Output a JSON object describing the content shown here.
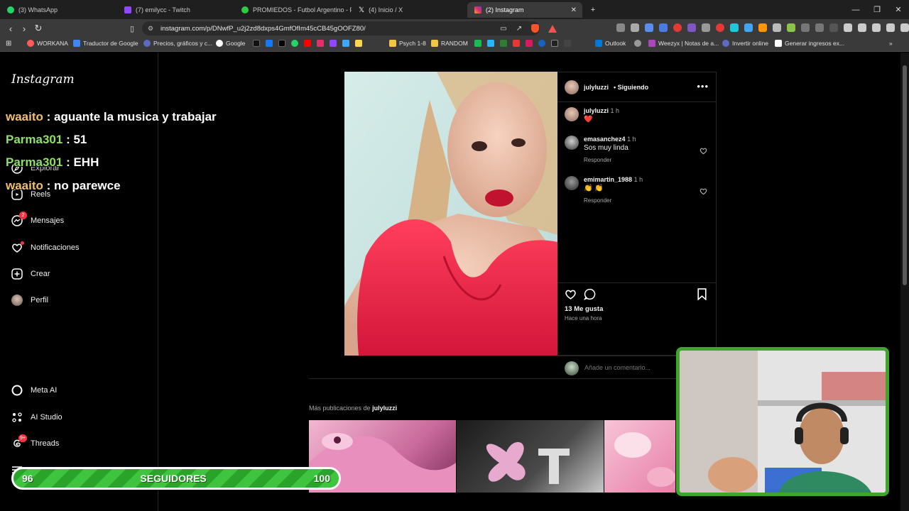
{
  "browser": {
    "tabs": [
      {
        "title": "(3) WhatsApp",
        "color": "#25d366"
      },
      {
        "title": "(7) emilycc - Twitch",
        "color": "#9146ff"
      },
      {
        "title": "PROMIEDOS - Futbol Argentino - Fix",
        "color": "#2ecc40"
      },
      {
        "title": "(4) Inicio / X",
        "color": "#ffffff"
      },
      {
        "title": "(2) Instagram",
        "color": "#e1306c"
      }
    ],
    "url": "instagram.com/p/DNwfP_u2j2zd8dxps4GmfOfIm45cCB45gOOFZ80/",
    "bookmarks": [
      "WORKANA",
      "Traductor de Google",
      "Precios, gráficos y c...",
      "Google",
      "Psych 1-8",
      "RANDOM",
      "Outlook",
      "Weezyx | Notas de a...",
      "Invertir online",
      "Generar ingresos ex..."
    ]
  },
  "instagram": {
    "logo": "Instagram",
    "nav": [
      {
        "label": "Explorar"
      },
      {
        "label": "Reels"
      },
      {
        "label": "Mensajes",
        "badge": "2"
      },
      {
        "label": "Notificaciones"
      },
      {
        "label": "Crear"
      },
      {
        "label": "Perfil"
      }
    ],
    "nav_bottom": [
      {
        "label": "Meta AI"
      },
      {
        "label": "AI Studio"
      },
      {
        "label": "Threads",
        "badge": "9+"
      }
    ],
    "post": {
      "header_user": "julyluzzi",
      "header_status": "• Siguiendo",
      "caption_user": "julyluzzi",
      "caption_time": "1 h",
      "caption_text": "❤️",
      "comments": [
        {
          "user": "emasanchez4",
          "time": "1 h",
          "text": "Sos muy linda",
          "reply": "Responder"
        },
        {
          "user": "emimartin_1988",
          "time": "1 h",
          "text": "👏 👏",
          "reply": "Responder"
        }
      ],
      "likes": "13 Me gusta",
      "posted": "Hace una hora",
      "comment_placeholder": "Añade un comentario..."
    },
    "more_prefix": "Más publicaciones de",
    "more_user": "julyluzzi"
  },
  "overlay": {
    "chat": [
      {
        "user": "waaito",
        "msg": " : aguante la musica y trabajar"
      },
      {
        "user": "Parma301",
        "msg": " : 51"
      },
      {
        "user": "Parma301",
        "msg": " : EHH"
      },
      {
        "user": "waaito",
        "msg": " : no parewce"
      }
    ],
    "followers": {
      "current": "96",
      "label": "SEGUIDORES",
      "goal": "100"
    }
  }
}
